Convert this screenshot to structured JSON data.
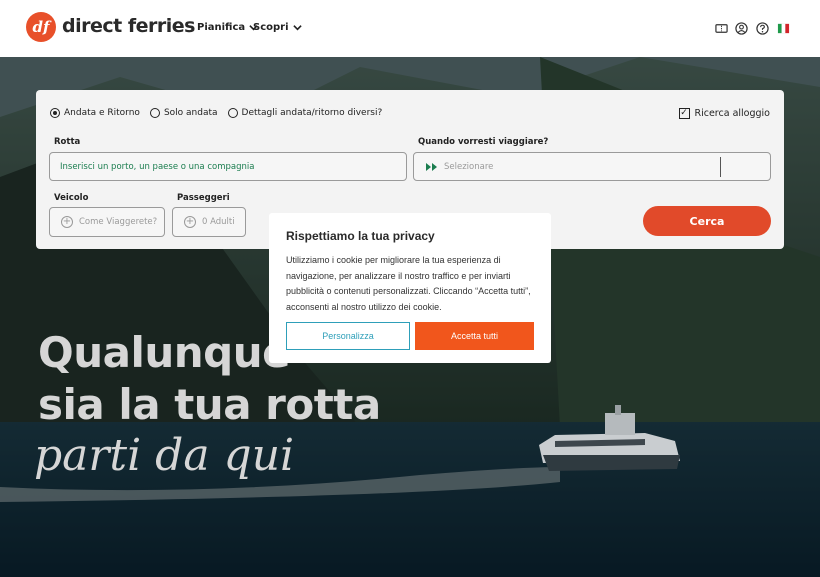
{
  "header": {
    "logo_badge": "df",
    "logo_text": "direct ferries",
    "nav": [
      {
        "label": "Pianifica",
        "icon": "chevron-down-icon"
      },
      {
        "label": "Scopri",
        "icon": "chevron-down-icon"
      }
    ],
    "icons": [
      "ticket-icon",
      "user-icon",
      "help-icon",
      "italy-flag-icon"
    ]
  },
  "search": {
    "trip_options": [
      {
        "label": "Andata e Ritorno",
        "selected": true
      },
      {
        "label": "Solo andata",
        "selected": false
      },
      {
        "label": "Dettagli andata/ritorno diversi?",
        "selected": false
      }
    ],
    "accommodation": {
      "label": "Ricerca alloggio",
      "checked": true
    },
    "route_label": "Rotta",
    "route_placeholder": "Inserisci un porto, un paese o una compagnia",
    "when_label": "Quando vorresti viaggiare?",
    "when_placeholder": "Selezionare",
    "vehicle_label": "Veicolo",
    "vehicle_placeholder": "Come Viaggerete?",
    "passengers_label": "Passeggeri",
    "passengers_value": "0 Adulti",
    "search_button": "Cerca"
  },
  "hero": {
    "line1": "Qualunque",
    "line2": "sia la tua rotta",
    "line3": "parti da qui"
  },
  "cookie_modal": {
    "title": "Rispettiamo la tua privacy",
    "body": "Utilizziamo i cookie per migliorare la tua esperienza di navigazione, per analizzare il nostro traffico e per inviarti pubblicità o contenuti personalizzati. Cliccando “Accetta tutti”, acconsenti al nostro utilizzo dei cookie.",
    "customize_button": "Personalizza",
    "accept_button": "Accetta tutti"
  },
  "colors": {
    "brand": "#e8502a",
    "accept": "#f1561c",
    "customize": "#2e9fb9"
  }
}
